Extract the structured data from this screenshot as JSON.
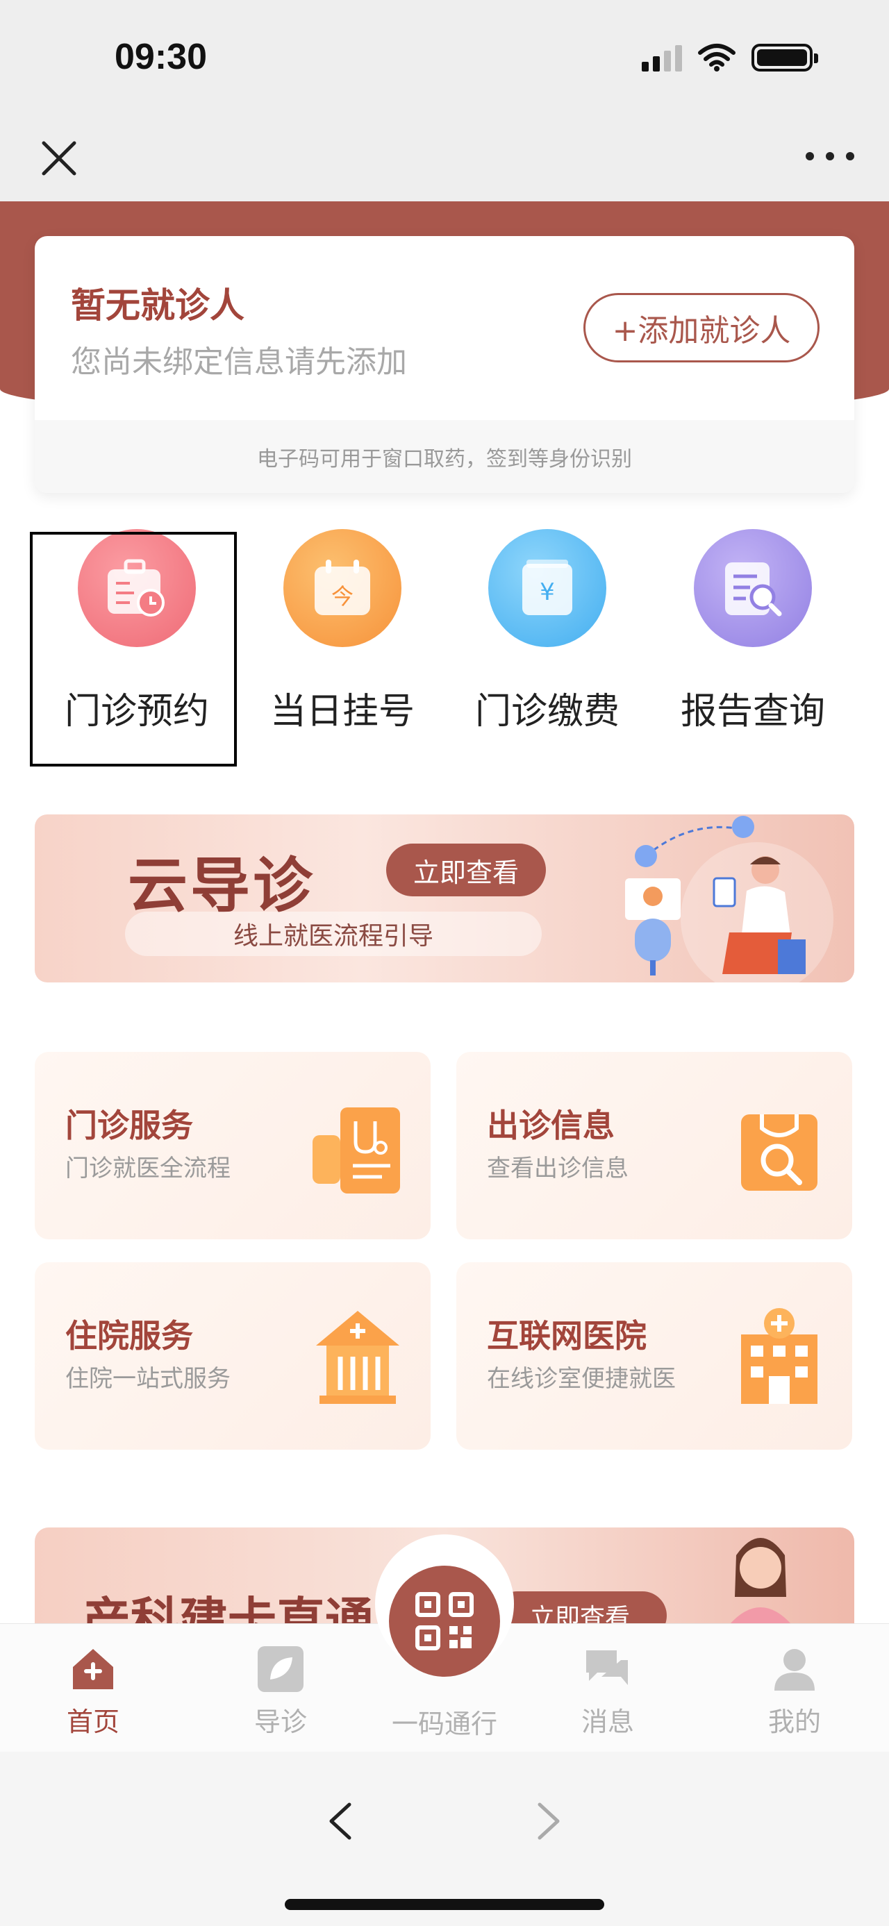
{
  "status_bar": {
    "time": "09:30"
  },
  "patient": {
    "title": "暂无就诊人",
    "subtitle": "您尚未绑定信息请先添加",
    "add_label": "+添加就诊人",
    "footer_note": "电子码可用于窗口取药，签到等身份识别"
  },
  "quick_actions": [
    {
      "label": "门诊预约",
      "icon": "appointment-icon",
      "color": "#f47c84"
    },
    {
      "label": "当日挂号",
      "icon": "calendar-today-icon",
      "color": "#fba24a"
    },
    {
      "label": "门诊缴费",
      "icon": "payment-yen-icon",
      "color": "#5cbcf5"
    },
    {
      "label": "报告查询",
      "icon": "report-search-icon",
      "color": "#a08be8"
    }
  ],
  "guide_banner": {
    "title": "云导诊",
    "cta": "立即查看",
    "subtitle": "线上就医流程引导"
  },
  "services": [
    {
      "title": "门诊服务",
      "subtitle": "门诊就医全流程",
      "icon": "stethoscope-icon"
    },
    {
      "title": "出诊信息",
      "subtitle": "查看出诊信息",
      "icon": "bag-search-icon"
    },
    {
      "title": "住院服务",
      "subtitle": "住院一站式服务",
      "icon": "hospital-building-icon"
    },
    {
      "title": "互联网医院",
      "subtitle": "在线诊室便捷就医",
      "icon": "internet-hospital-icon"
    }
  ],
  "promo_banner": {
    "title": "产科建卡直通",
    "cta": "立即查看"
  },
  "tabs": [
    {
      "label": "首页",
      "icon": "home-icon",
      "active": true
    },
    {
      "label": "导诊",
      "icon": "guide-leaf-icon",
      "active": false
    },
    {
      "label": "一码通行",
      "icon": "qr-code-icon",
      "active": false
    },
    {
      "label": "消息",
      "icon": "message-icon",
      "active": false
    },
    {
      "label": "我的",
      "icon": "user-icon",
      "active": false
    }
  ],
  "colors": {
    "brand": "#a9574c",
    "brand_text": "#a2453b"
  }
}
